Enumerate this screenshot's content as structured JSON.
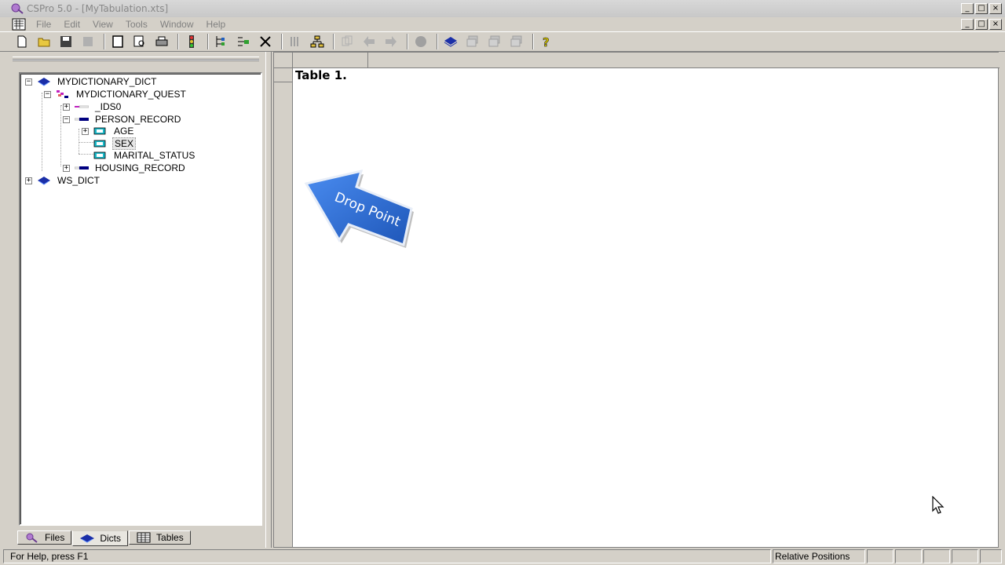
{
  "window": {
    "title": "CSPro 5.0 - [MyTabulation.xts]",
    "controls": {
      "minimize": "_",
      "maximize": "□",
      "close": "×"
    }
  },
  "menu": {
    "items": [
      "File",
      "Edit",
      "View",
      "Tools",
      "Window",
      "Help"
    ]
  },
  "toolbar": {
    "buttons": [
      "new-icon",
      "open-icon",
      "save-icon",
      "save-all-icon",
      "page-icon",
      "preview-icon",
      "print-icon",
      "run-icon",
      "insert-icon",
      "add-icon",
      "delete-icon",
      "layout-icon",
      "tree-icon",
      "copy-icon",
      "back-icon",
      "forward-icon",
      "record-icon",
      "dict-icon",
      "area-icon",
      "area2-icon",
      "area3-icon",
      "help-icon"
    ]
  },
  "tree": {
    "items": [
      {
        "label": "MYDICTIONARY_DICT",
        "level": 0,
        "expander": "−",
        "icon": "dictionary-icon"
      },
      {
        "label": "MYDICTIONARY_QUEST",
        "level": 1,
        "expander": "−",
        "icon": "questionnaire-icon"
      },
      {
        "label": "_IDS0",
        "level": 2,
        "expander": "+",
        "icon": "id-record-icon"
      },
      {
        "label": "PERSON_RECORD",
        "level": 2,
        "expander": "−",
        "icon": "record-icon"
      },
      {
        "label": "AGE",
        "level": 3,
        "expander": "+",
        "icon": "item-icon"
      },
      {
        "label": "SEX",
        "level": 3,
        "expander": "",
        "icon": "item-icon",
        "selected": true
      },
      {
        "label": "MARITAL_STATUS",
        "level": 3,
        "expander": "",
        "icon": "item-icon"
      },
      {
        "label": "HOUSING_RECORD",
        "level": 2,
        "expander": "+",
        "icon": "record-icon"
      },
      {
        "label": "WS_DICT",
        "level": 0,
        "expander": "+",
        "icon": "dictionary-icon"
      }
    ]
  },
  "tabs": [
    {
      "label": "Files",
      "icon": "files-icon",
      "active": false
    },
    {
      "label": "Dicts",
      "icon": "dicts-icon",
      "active": true
    },
    {
      "label": "Tables",
      "icon": "tables-icon",
      "active": false
    }
  ],
  "table": {
    "title": "Table 1."
  },
  "annotation": {
    "label": "Drop Point",
    "color": "#2a6fd6"
  },
  "status": {
    "help": "For Help, press F1",
    "positions": "Relative Positions"
  },
  "colors": {
    "dictionary": "#1b2fa8",
    "item": "#19b8c8",
    "record": "#000080",
    "ids": "#c020c0"
  }
}
